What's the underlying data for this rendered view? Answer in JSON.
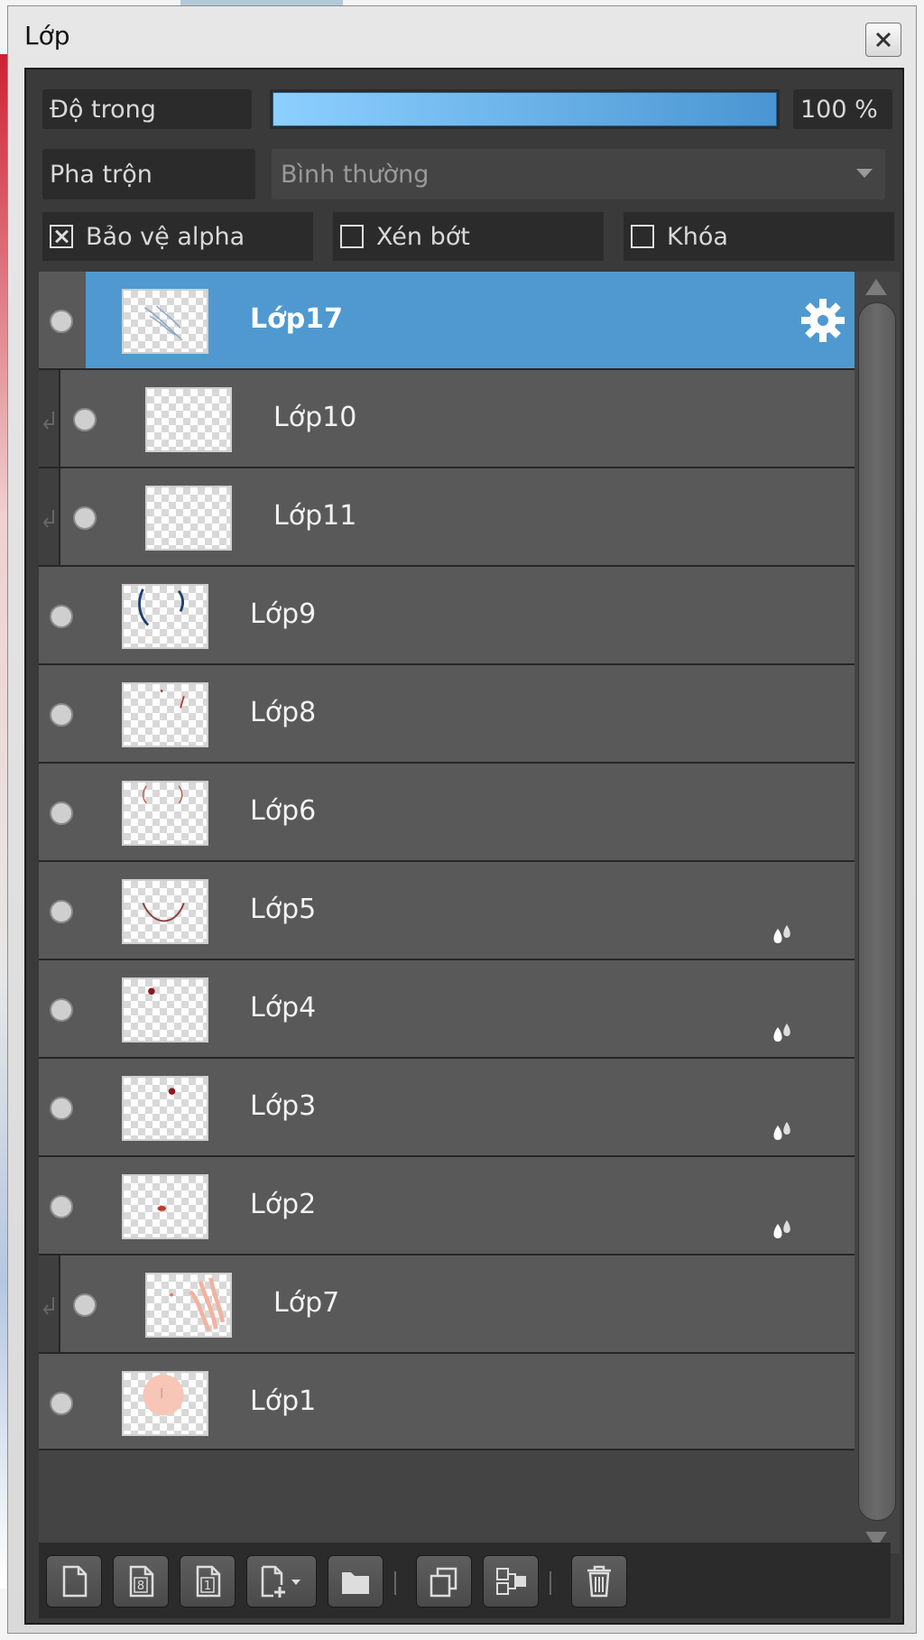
{
  "window": {
    "title": "Lớp"
  },
  "opacity": {
    "label": "Độ trong",
    "value_text": "100 %",
    "percent": 100
  },
  "blend": {
    "label": "Pha trộn",
    "value": "Bình thường"
  },
  "checkboxes": [
    {
      "label": "Bảo vệ alpha",
      "checked": true
    },
    {
      "label": "Xén bớt",
      "checked": false
    },
    {
      "label": "Khóa",
      "checked": false
    }
  ],
  "layers": [
    {
      "name": "Lớp17",
      "selected": true,
      "clipped": false,
      "settings_icon": "gear-icon"
    },
    {
      "name": "Lớp10",
      "clipped": true
    },
    {
      "name": "Lớp11",
      "clipped": true
    },
    {
      "name": "Lớp9"
    },
    {
      "name": "Lớp8"
    },
    {
      "name": "Lớp6"
    },
    {
      "name": "Lớp5",
      "status_icon": "drops-icon"
    },
    {
      "name": "Lớp4",
      "status_icon": "drops-icon"
    },
    {
      "name": "Lớp3",
      "status_icon": "drops-icon"
    },
    {
      "name": "Lớp2",
      "status_icon": "drops-icon"
    },
    {
      "name": "Lớp7",
      "clipped": true
    },
    {
      "name": "Lớp1"
    }
  ],
  "toolbar": {
    "buttons": [
      "new-layer-icon",
      "new-8bit-layer-icon",
      "new-1bit-layer-icon",
      "add-layer-dropdown-icon",
      "new-folder-icon",
      "duplicate-layer-icon",
      "merge-down-icon",
      "delete-layer-icon"
    ],
    "badge_8": "8",
    "badge_1": "1"
  }
}
